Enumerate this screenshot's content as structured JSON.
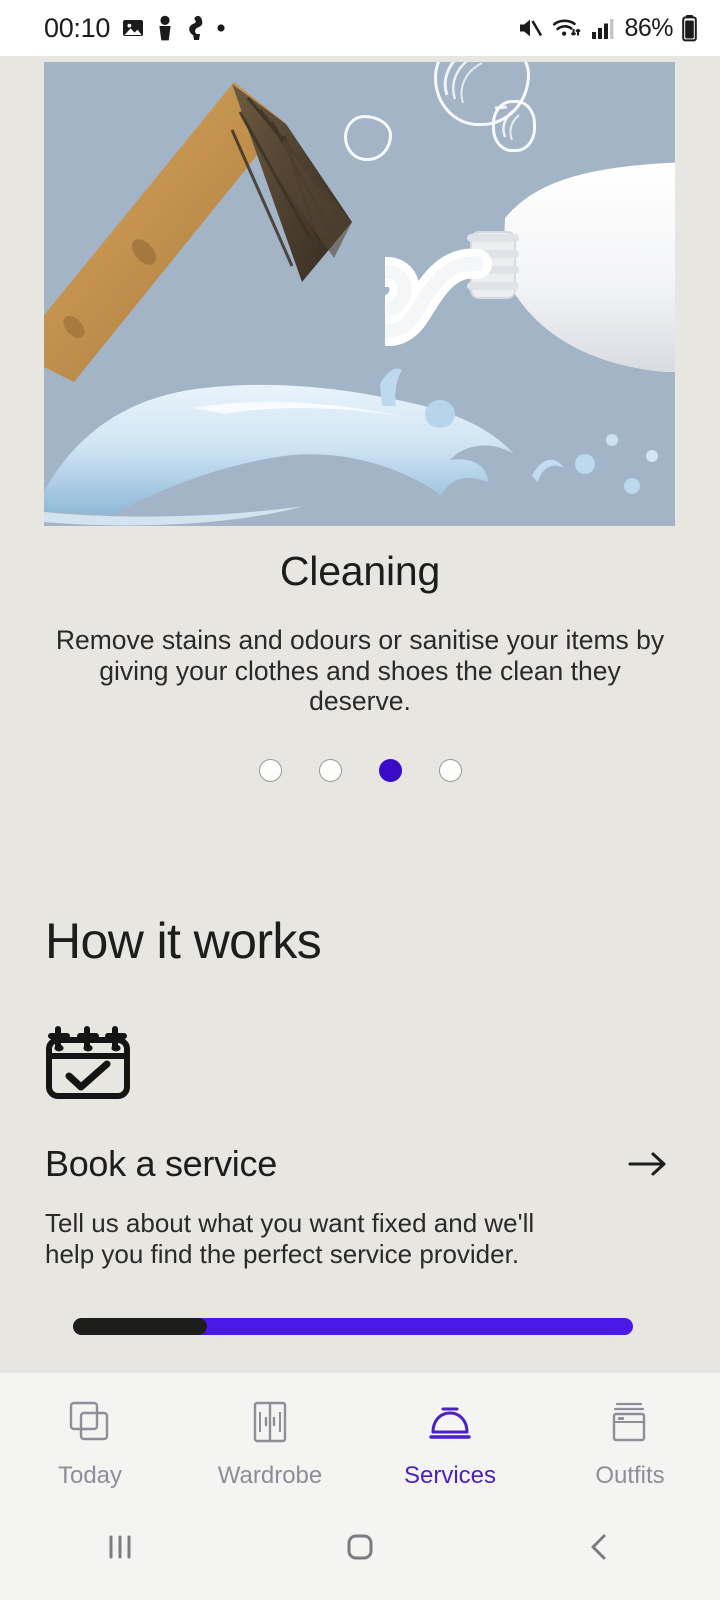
{
  "status_bar": {
    "time": "00:10",
    "battery_percent": "86%",
    "left_icons": [
      "image-icon",
      "app-badge-icon",
      "app-badge-icon-2",
      "dot-icon"
    ],
    "right_icons": [
      "mute-icon",
      "wifi-icon",
      "signal-icon",
      "battery-icon"
    ]
  },
  "carousel": {
    "slide_title": "Cleaning",
    "slide_description": "Remove stains and odours or sanitise your items by giving your clothes and shoes the clean they deserve.",
    "hero_alt": "cleaning-brush-toothpaste-water-splash",
    "dots": [
      {
        "active": false
      },
      {
        "active": false
      },
      {
        "active": true
      },
      {
        "active": false
      }
    ],
    "active_index": 2,
    "dot_active_color": "#3a0cc8"
  },
  "how_it_works": {
    "heading": "How it works",
    "step": {
      "icon": "calendar-check-icon",
      "title": "Book a service",
      "description": "Tell us about what you want fixed and we'll help you find the perfect service provider.",
      "arrow_icon": "arrow-right-icon"
    },
    "progress": {
      "percent": 24,
      "track_color": "#4a18e8",
      "fill_color": "#1d1d1b"
    }
  },
  "tabbar": {
    "items": [
      {
        "label": "Today",
        "icon": "stacked-squares-icon",
        "active": false
      },
      {
        "label": "Wardrobe",
        "icon": "wardrobe-icon",
        "active": false
      },
      {
        "label": "Services",
        "icon": "service-bell-icon",
        "active": true
      },
      {
        "label": "Outfits",
        "icon": "outfits-stack-icon",
        "active": false
      }
    ],
    "active_color": "#4b1fc4",
    "inactive_color": "#8e8e98"
  },
  "android_nav": {
    "recents_label": "recents-icon",
    "home_label": "home-icon",
    "back_label": "back-icon"
  },
  "theme": {
    "page_background": "#e8e6e1",
    "hero_background": "#a3b4c7",
    "text_primary": "#1d1d1b"
  }
}
